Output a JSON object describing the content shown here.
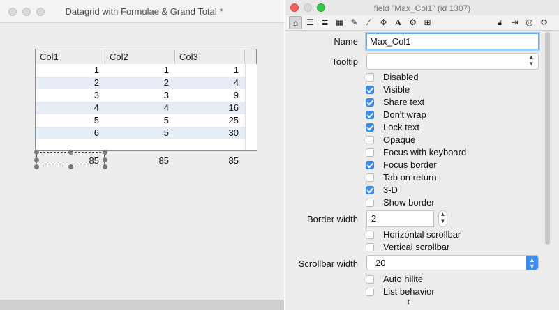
{
  "window_left": {
    "title": "Datagrid with Formulae & Grand Total *"
  },
  "datagrid": {
    "columns": [
      "Col1",
      "Col2",
      "Col3"
    ],
    "rows": [
      [
        "1",
        "1",
        "1"
      ],
      [
        "2",
        "2",
        "4"
      ],
      [
        "3",
        "3",
        "9"
      ],
      [
        "4",
        "4",
        "16"
      ],
      [
        "5",
        "5",
        "25"
      ],
      [
        "6",
        "5",
        "30"
      ]
    ],
    "totals": [
      "85",
      "85",
      "85"
    ]
  },
  "window_right": {
    "title": "field \"Max_Col1\" (id 1307)",
    "toolbar_icons": [
      "home-icon",
      "list-icon",
      "database-icon",
      "grid-icon",
      "pencil-icon",
      "wand-icon",
      "move-icon",
      "text-icon",
      "gear-cluster-icon",
      "crosshair-icon",
      "lock-icon",
      "export-icon",
      "target-icon",
      "settings-icon"
    ],
    "name_label": "Name",
    "name_value": "Max_Col1",
    "tooltip_label": "Tooltip",
    "tooltip_value": "",
    "checkboxes": [
      {
        "label": "Disabled",
        "checked": false
      },
      {
        "label": "Visible",
        "checked": true
      },
      {
        "label": "Share text",
        "checked": true
      },
      {
        "label": "Don't wrap",
        "checked": true
      },
      {
        "label": "Lock text",
        "checked": true
      },
      {
        "label": "Opaque",
        "checked": false
      },
      {
        "label": "Focus with keyboard",
        "checked": false
      },
      {
        "label": "Focus border",
        "checked": true
      },
      {
        "label": "Tab on return",
        "checked": false
      },
      {
        "label": "3-D",
        "checked": true
      },
      {
        "label": "Show border",
        "checked": false
      }
    ],
    "border_width_label": "Border width",
    "border_width_value": "2",
    "checkboxes2": [
      {
        "label": "Horizontal scrollbar",
        "checked": false
      },
      {
        "label": "Vertical scrollbar",
        "checked": false
      }
    ],
    "scrollbar_width_label": "Scrollbar width",
    "scrollbar_width_value": "20",
    "checkboxes3": [
      {
        "label": "Auto hilite",
        "checked": false
      },
      {
        "label": "List behavior",
        "checked": false
      }
    ]
  },
  "colors": {
    "accent": "#3b8ef0",
    "row_alt": "#e6edf7",
    "close": "#fc605c",
    "minimize": "#fdbc40",
    "zoom": "#34c84a"
  }
}
